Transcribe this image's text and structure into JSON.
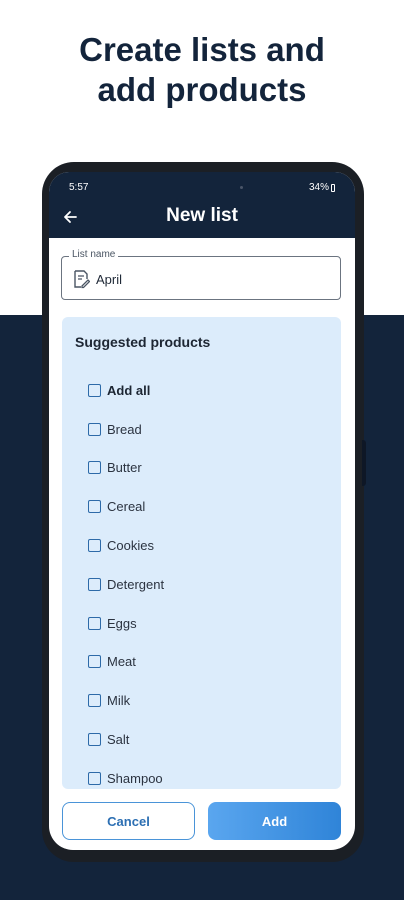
{
  "headline": {
    "line1": "Create lists and",
    "line2": "add products"
  },
  "status": {
    "time": "5:57",
    "battery": "34%"
  },
  "appbar": {
    "title": "New list",
    "back_icon": "arrow-left-icon"
  },
  "list_name": {
    "label": "List name",
    "value": "April",
    "icon": "edit-note-icon"
  },
  "suggested": {
    "title": "Suggested products",
    "items": [
      {
        "label": "Add all",
        "checked": false
      },
      {
        "label": "Bread",
        "checked": false
      },
      {
        "label": "Butter",
        "checked": false
      },
      {
        "label": "Cereal",
        "checked": false
      },
      {
        "label": "Cookies",
        "checked": false
      },
      {
        "label": "Detergent",
        "checked": false
      },
      {
        "label": "Eggs",
        "checked": false
      },
      {
        "label": "Meat",
        "checked": false
      },
      {
        "label": "Milk",
        "checked": false
      },
      {
        "label": "Salt",
        "checked": false
      },
      {
        "label": "Shampoo",
        "checked": false
      }
    ]
  },
  "actions": {
    "cancel_label": "Cancel",
    "add_label": "Add"
  },
  "colors": {
    "navy": "#13243b",
    "panel": "#dcecfb",
    "accent": "#2f84d8"
  }
}
